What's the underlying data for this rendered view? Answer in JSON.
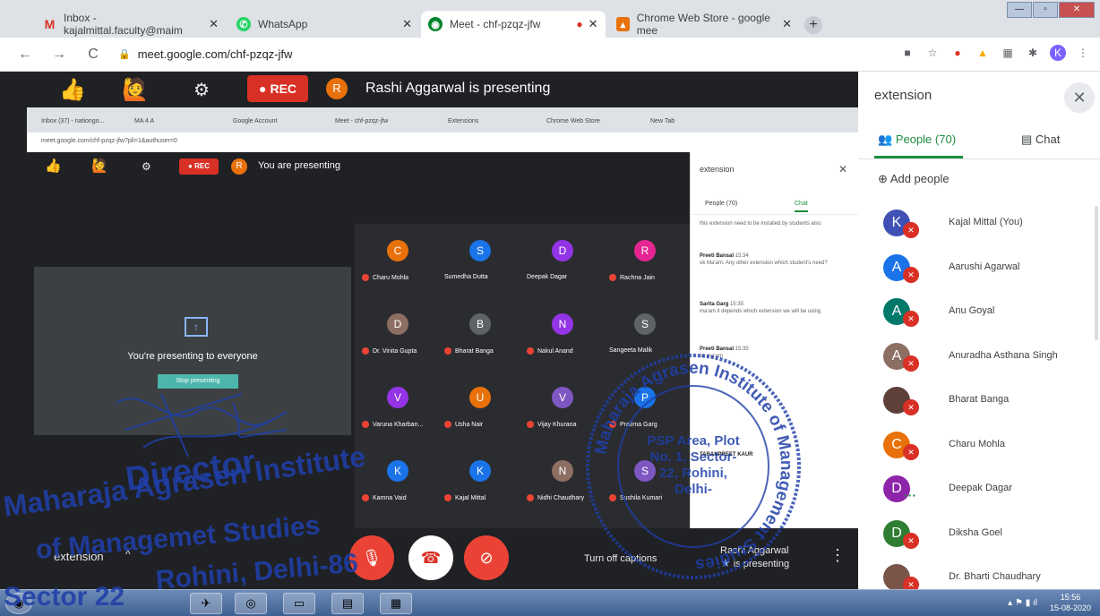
{
  "browser": {
    "tabs": [
      {
        "label": "Inbox - kajalmittal.faculty@maim",
        "icon": "gmail-icon",
        "color": "#d93025"
      },
      {
        "label": "WhatsApp",
        "icon": "whatsapp-icon",
        "color": "#25d366"
      },
      {
        "label": "Meet - chf-pzqz-jfw",
        "icon": "meet-icon",
        "color": "#00832d"
      },
      {
        "label": "Chrome Web Store - google mee",
        "icon": "webstore-icon",
        "color": "#e8710a"
      }
    ],
    "url": "meet.google.com/chf-pzqz-jfw",
    "profile_initial": "K"
  },
  "meet_bar": {
    "rec_label": "REC",
    "presenter_initial": "R",
    "presenting_text": "Rashi Aggarwal is presenting"
  },
  "shared_screen": {
    "tabs": [
      "Inbox (37) - nationgo...",
      "MA 4 A",
      "Google Account",
      "Meet - chf-pzqz-jfw",
      "Extensions",
      "Chrome Web Store",
      "New Tab"
    ],
    "url": "meet.google.com/chf-pzqz-jfw?pli=1&authuser=0",
    "rec_label": "REC",
    "presenter_initial": "R",
    "presenting_text": "You are presenting",
    "card_text": "You're presenting to everyone",
    "stop_label": "Stop presenting",
    "side_header": "extension",
    "people_tab": "People (70)",
    "chat_tab": "Chat",
    "tiles": [
      {
        "initial": "C",
        "name": "Charu Mohla",
        "color": "#e8710a"
      },
      {
        "initial": "S",
        "name": "Sumedha Dutta",
        "color": "#1a73e8"
      },
      {
        "initial": "D",
        "name": "Deepak Dagar",
        "color": "#9334e6"
      },
      {
        "initial": "R",
        "name": "Rachna Jain",
        "color": "#e52592"
      },
      {
        "initial": "D",
        "name": "Dr. Vinita Gupta",
        "color": "#8d6e63"
      },
      {
        "initial": "B",
        "name": "Bharat Banga",
        "color": "#5f6368"
      },
      {
        "initial": "N",
        "name": "Nakul Anand",
        "color": "#9334e6"
      },
      {
        "initial": "S",
        "name": "Sangeeta Malik",
        "color": "#5f6368"
      },
      {
        "initial": "V",
        "name": "Varuna Kharban...",
        "color": "#9334e6"
      },
      {
        "initial": "U",
        "name": "Usha Nair",
        "color": "#e8710a"
      },
      {
        "initial": "V",
        "name": "Vijay Khurana",
        "color": "#7e57c2"
      },
      {
        "initial": "P",
        "name": "Pratima Garg",
        "color": "#1a73e8"
      },
      {
        "initial": "K",
        "name": "Kamna Vaid",
        "color": "#1a73e8"
      },
      {
        "initial": "K",
        "name": "Kajal Mittal",
        "color": "#1a73e8"
      },
      {
        "initial": "N",
        "name": "Nidhi Chaudhary",
        "color": "#8d6e63"
      },
      {
        "initial": "S",
        "name": "Sushila Kumari",
        "color": "#7e57c2"
      }
    ],
    "messages": [
      {
        "sender": "",
        "time": "",
        "text": "this extension need to be installed by students also"
      },
      {
        "sender": "Preeti Bansal",
        "time": "15:34",
        "text": "ok Ma'am. Any other extension which student's need?"
      },
      {
        "sender": "Sarita Garg",
        "time": "15:35",
        "text": "ma'am it depends which extension we will be using"
      },
      {
        "sender": "Preeti Bansal",
        "time": "15:35",
        "text": "ok ma'am"
      },
      {
        "sender": "TARANPREET KAUR",
        "time": "",
        "text": ""
      }
    ]
  },
  "panel": {
    "header": "extension",
    "people_tab": "People (70)",
    "chat_tab": "Chat",
    "add_people": "Add people",
    "people": [
      {
        "initial": "K",
        "name": "Kajal Mittal (You)",
        "color": "#3f51b5",
        "status": "muted"
      },
      {
        "initial": "A",
        "name": "Aarushi Agarwal",
        "color": "#1a73e8",
        "status": "muted"
      },
      {
        "initial": "A",
        "name": "Anu Goyal",
        "color": "#00796b",
        "status": "muted"
      },
      {
        "initial": "A",
        "name": "Anuradha Asthana Singh",
        "color": "#8d6e63",
        "status": "muted"
      },
      {
        "initial": "B",
        "name": "Bharat Banga",
        "color": "#5d4037",
        "status": "muted"
      },
      {
        "initial": "C",
        "name": "Charu Mohla",
        "color": "#e8710a",
        "status": "muted"
      },
      {
        "initial": "D",
        "name": "Deepak Dagar",
        "color": "#8e24aa",
        "status": "speaking"
      },
      {
        "initial": "D",
        "name": "Diksha Goel",
        "color": "#2e7d32",
        "status": "muted"
      },
      {
        "initial": "B",
        "name": "Dr. Bharti Chaudhary",
        "color": "#795548",
        "status": "muted"
      }
    ]
  },
  "bottom_bar": {
    "extension_label": "extension",
    "turn_off_label": "Turn off captions",
    "presenter_name": "Rashi Aggarwal",
    "presenter_status": "is presenting"
  },
  "taskbar": {
    "time": "15:56",
    "date": "15-08-2020"
  },
  "stamp": {
    "ring_text": "Maharaja Agrasen Institute of Management Studies",
    "center_text": "PSP Area, Plot No. 1, Sector-22, Rohini, Delhi-"
  },
  "signature_block": {
    "line1": "Director",
    "line2": "Maharaja Agrasen Institute",
    "line3": "of Managemet Studies",
    "line4": "Rohini, Delhi-86",
    "line5": "Sector 22"
  },
  "colors": {
    "meet_bg": "#202124",
    "accent_green": "#1e8e3e",
    "rec_red": "#d93025",
    "stamp_blue": "#1f3fa8"
  }
}
